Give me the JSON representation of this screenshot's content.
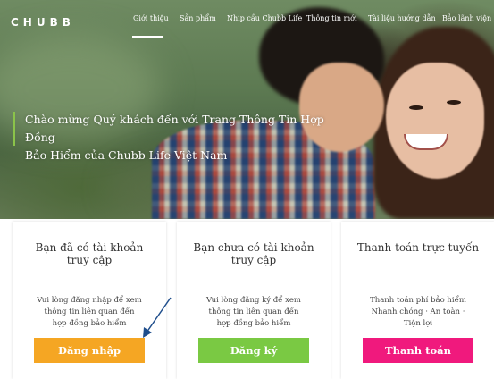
{
  "header": {
    "logo": "CHUBB",
    "nav": [
      {
        "label": "Giới thiệu",
        "active": true
      },
      {
        "label": "Sản phẩm"
      },
      {
        "label": "Nhịp cầu Chubb Life"
      },
      {
        "label": "Thông tin mới"
      },
      {
        "label": "Tài liệu hướng dẫn"
      },
      {
        "label": "Bảo lãnh viện phí"
      }
    ]
  },
  "hero": {
    "title_line1": "Chào mừng Quý khách đến với Trang Thông Tin Hợp Đồng",
    "title_line2": "Bảo Hiểm của Chubb Life Việt Nam"
  },
  "cards": [
    {
      "title_line1": "Bạn đã có tài khoản",
      "title_line2": "truy cập",
      "desc_line1": "Vui lòng đăng nhập để xem",
      "desc_line2": "thông tin liên quan đến",
      "desc_line3": "hợp đồng bảo hiểm",
      "button": "Đăng nhập",
      "button_color": "#f5a623"
    },
    {
      "title_line1": "Bạn chưa có tài khoản",
      "title_line2": "truy cập",
      "desc_line1": "Vui lòng đăng ký để xem",
      "desc_line2": "thông tin liên quan đến",
      "desc_line3": "hợp đồng bảo hiểm",
      "button": "Đăng ký",
      "button_color": "#7ac943"
    },
    {
      "title_line1": "Thanh toán trực tuyến",
      "title_line2": "",
      "desc_line1": "Thanh toán phí bảo hiểm",
      "desc_line2": "Nhanh chóng · An toàn ·",
      "desc_line3": "Tiện lợi",
      "button": "Thanh toán",
      "button_color": "#f0197d"
    }
  ],
  "colors": {
    "accent_green": "#8bc34a",
    "arrow": "#1f4e8c"
  },
  "annotation": {
    "icon": "arrow-pointer-icon"
  }
}
